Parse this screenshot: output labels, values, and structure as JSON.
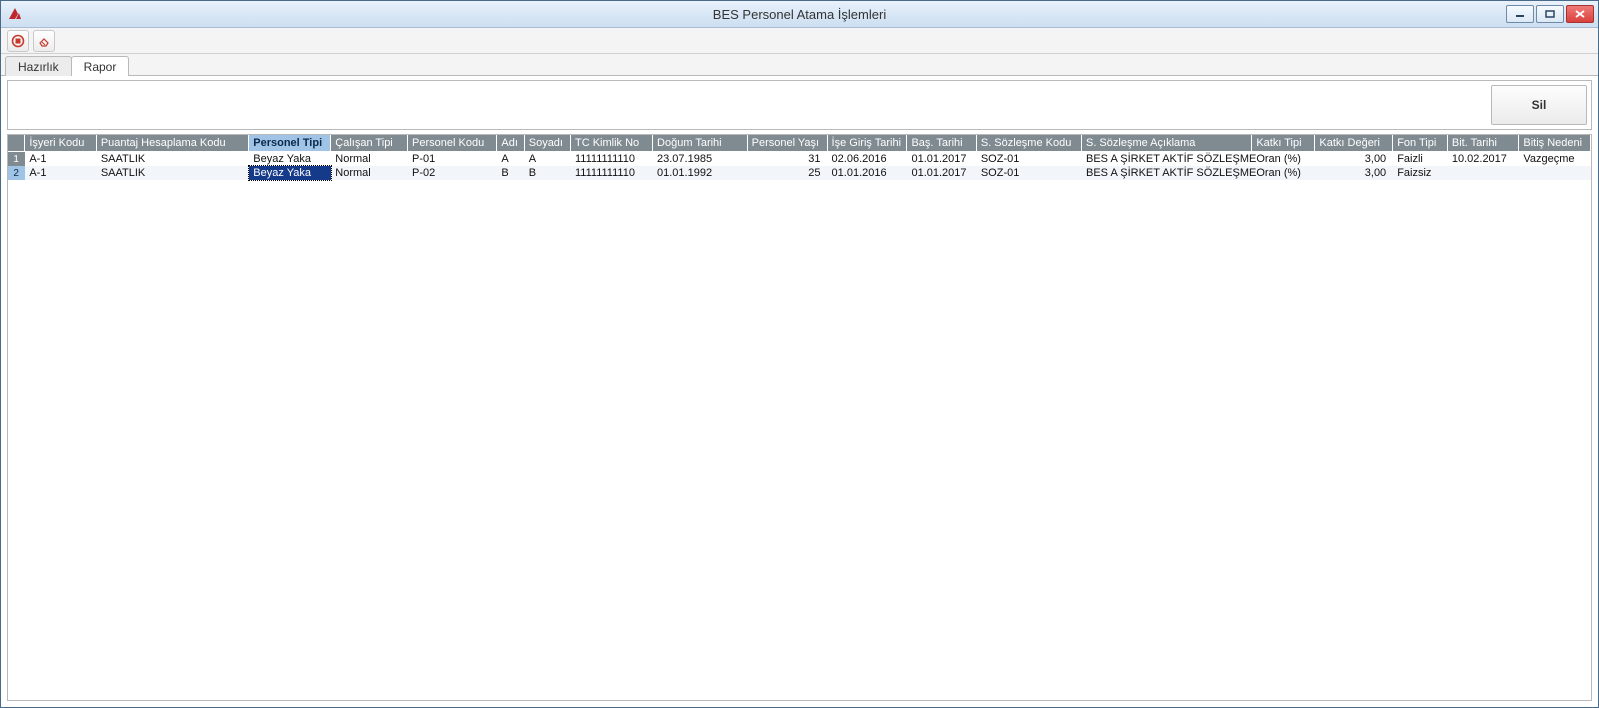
{
  "window": {
    "title": "BES Personel Atama İşlemleri"
  },
  "tabs": {
    "left": "Hazırlık",
    "right": "Rapor",
    "active": "Rapor"
  },
  "buttons": {
    "delete": "Sil"
  },
  "columns": [
    "",
    "İşyeri Kodu",
    "Puantaj Hesaplama Kodu",
    "Personel Tipi",
    "Çalışan Tipi",
    "Personel Kodu",
    "Adı",
    "Soyadı",
    "TC Kimlik No",
    "Doğum Tarihi",
    "Personel Yaşı",
    "İşe Giriş Tarihi",
    "Baş. Tarihi",
    "S. Sözleşme Kodu",
    "S. Sözleşme Açıklama",
    "Katkı Tipi",
    "Katkı Değeri",
    "Fon Tipi",
    "Bit. Tarihi",
    "Bitiş Nedeni"
  ],
  "sorted_column_index": 3,
  "rows": [
    {
      "num": "1",
      "isyeri": "A-1",
      "puantaj": "SAATLIK",
      "personel_tipi": "Beyaz Yaka",
      "calisan_tipi": "Normal",
      "personel_kodu": "P-01",
      "adi": "A",
      "soyadi": "A",
      "tc": "11111111110",
      "dogum": "23.07.1985",
      "yas": "31",
      "ise_giris": "02.06.2016",
      "bas_tarihi": "01.01.2017",
      "soz_kodu": "SOZ-01",
      "soz_aciklama": "BES A ŞİRKET AKTİF SÖZLEŞME",
      "katki_tipi": "Oran (%)",
      "katki_degeri": "3,00",
      "fon_tipi": "Faizli",
      "bit_tarihi": "10.02.2017",
      "bitis_nedeni": "Vazgeçme"
    },
    {
      "num": "2",
      "isyeri": "A-1",
      "puantaj": "SAATLIK",
      "personel_tipi": "Beyaz Yaka",
      "calisan_tipi": "Normal",
      "personel_kodu": "P-02",
      "adi": "B",
      "soyadi": "B",
      "tc": "11111111110",
      "dogum": "01.01.1992",
      "yas": "25",
      "ise_giris": "01.01.2016",
      "bas_tarihi": "01.01.2017",
      "soz_kodu": "SOZ-01",
      "soz_aciklama": "BES A ŞİRKET AKTİF SÖZLEŞME",
      "katki_tipi": "Oran (%)",
      "katki_degeri": "3,00",
      "fon_tipi": "Faizsiz",
      "bit_tarihi": "",
      "bitis_nedeni": ""
    }
  ],
  "selected_row": 1,
  "selected_cell_field": "personel_tipi"
}
